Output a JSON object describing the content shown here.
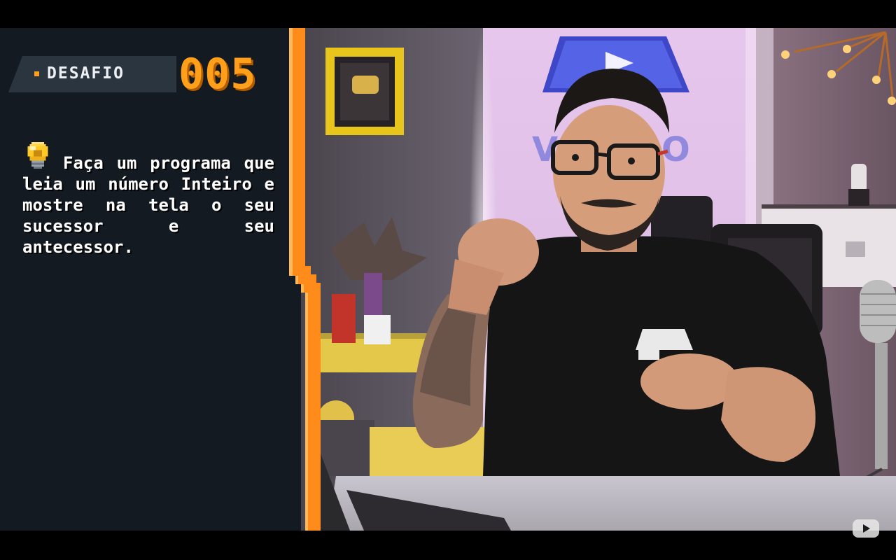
{
  "overlay": {
    "label": "DESAFIO",
    "number": "005",
    "text": "Faça um programa que leia um número Inteiro e mostre na tela o seu sucessor e seu antecessor.",
    "icon": "lightbulb-icon"
  },
  "colors": {
    "panel_bg": "#141a22",
    "accent_orange": "#ff9f1a",
    "text": "#ffffff"
  },
  "player": {
    "logo_icon": "youtube-logo-icon"
  }
}
